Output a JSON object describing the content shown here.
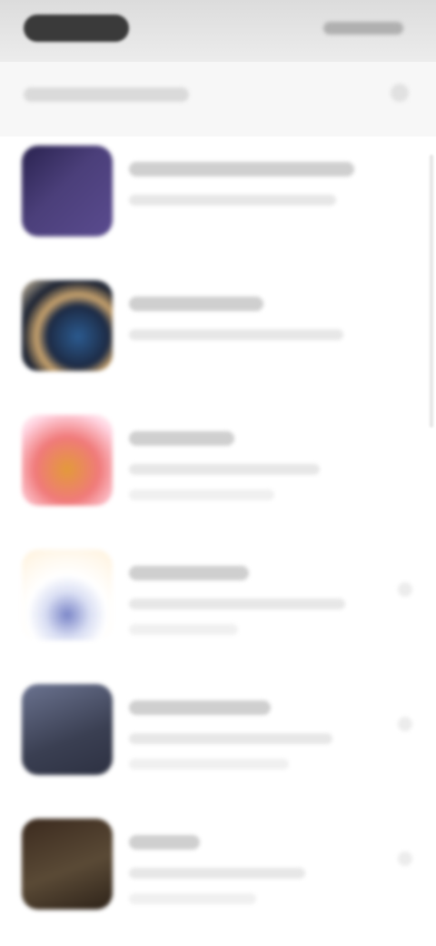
{
  "status_bar": {
    "time": "",
    "icons": "status-icons"
  },
  "header": {
    "title": "",
    "chevron_icon": "chevron-down-icon"
  },
  "list": {
    "items": [
      {
        "title": "",
        "subtitle": "",
        "thumb_color": "#4b3f7a"
      },
      {
        "title": "",
        "subtitle": "",
        "thumb_color": "#2b3f66"
      },
      {
        "title": "",
        "subtitle": "",
        "thumb_color": "#f07a7a"
      },
      {
        "title": "",
        "subtitle": "",
        "thumb_color": "#7b86c8"
      },
      {
        "title": "",
        "subtitle": "",
        "thumb_color": "#4e546a"
      },
      {
        "title": "",
        "subtitle": "",
        "thumb_color": "#5a4a36"
      }
    ]
  }
}
